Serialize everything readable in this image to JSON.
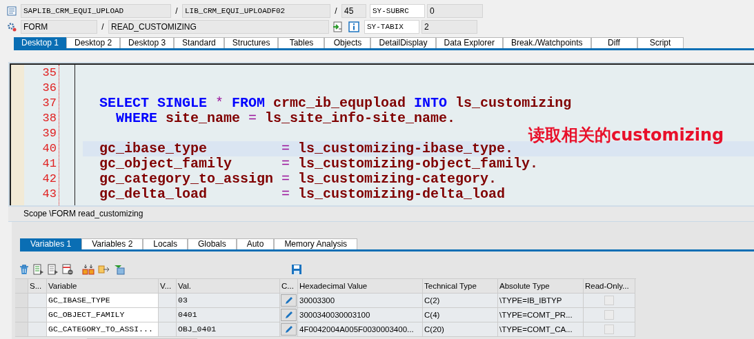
{
  "header": {
    "separators": [
      "/",
      "/",
      "/"
    ],
    "program": "SAPLIB_CRM_EQUI_UPLOAD",
    "include": "LIB_CRM_EQUI_UPLOADF02",
    "line": "45",
    "event_type": "FORM",
    "event_name": "READ_CUSTOMIZING",
    "system_fields": [
      {
        "name": "SY-SUBRC",
        "value": "0"
      },
      {
        "name": "SY-TABIX",
        "value": "2"
      }
    ]
  },
  "desktop_tabs": [
    {
      "label": "Desktop 1",
      "selected": true
    },
    {
      "label": "Desktop 2",
      "selected": false
    },
    {
      "label": "Desktop 3",
      "selected": false
    },
    {
      "label": "Standard",
      "selected": false
    },
    {
      "label": "Structures",
      "selected": false
    },
    {
      "label": "Tables",
      "selected": false
    },
    {
      "label": "Objects",
      "selected": false
    },
    {
      "label": "DetailDisplay",
      "selected": false
    },
    {
      "label": "Data Explorer",
      "selected": false
    },
    {
      "label": "Break./Watchpoints",
      "selected": false
    },
    {
      "label": "Diff",
      "selected": false
    },
    {
      "label": "Script",
      "selected": false
    }
  ],
  "code": {
    "lines": [
      {
        "number": "35",
        "current": false
      },
      {
        "number": "36",
        "current": false
      },
      {
        "number": "37",
        "current": false,
        "continuation": false,
        "tokens": [
          {
            "kind": "keyword",
            "text": "SELECT"
          },
          {
            "kind": "keyword",
            "text": "SINGLE"
          },
          {
            "kind": "operator",
            "text": "*"
          },
          {
            "kind": "keyword",
            "text": "FROM"
          },
          {
            "kind": "identifier",
            "text": "crmc_ib_equpload"
          },
          {
            "kind": "keyword",
            "text": "INTO"
          },
          {
            "kind": "identifier",
            "text": "ls_customizing"
          }
        ]
      },
      {
        "number": "38",
        "current": false,
        "continuation": true,
        "tokens": [
          {
            "kind": "keyword",
            "text": "WHERE"
          },
          {
            "kind": "identifier",
            "text": "site_name"
          },
          {
            "kind": "operator",
            "text": "="
          },
          {
            "kind": "identifier",
            "text": "ls_site_info-site_name."
          }
        ]
      },
      {
        "number": "39",
        "current": false
      },
      {
        "number": "40",
        "current": true,
        "continuation": false,
        "tokens": [
          {
            "kind": "target",
            "text": "gc_ibase_type"
          },
          {
            "kind": "operator",
            "text": "="
          },
          {
            "kind": "identifier",
            "text": "ls_customizing-ibase_type."
          }
        ]
      },
      {
        "number": "41",
        "current": false,
        "continuation": false,
        "tokens": [
          {
            "kind": "target",
            "text": "gc_object_family"
          },
          {
            "kind": "operator",
            "text": "="
          },
          {
            "kind": "identifier",
            "text": "ls_customizing-object_family."
          }
        ]
      },
      {
        "number": "42",
        "current": false,
        "continuation": false,
        "tokens": [
          {
            "kind": "target",
            "text": "gc_category_to_assign"
          },
          {
            "kind": "operator",
            "text": "="
          },
          {
            "kind": "identifier",
            "text": "ls_customizing-category."
          }
        ]
      },
      {
        "number": "43",
        "current": false,
        "continuation": false,
        "tokens": [
          {
            "kind": "target",
            "text": "gc_delta_load"
          },
          {
            "kind": "operator",
            "text": "="
          },
          {
            "kind": "identifier",
            "text": "ls_customizing-delta_load"
          }
        ]
      }
    ],
    "annotation": "读取相关的customizing"
  },
  "scope": "Scope \\FORM read_customizing",
  "variable_tabs": [
    {
      "label": "Variables 1",
      "selected": true
    },
    {
      "label": "Variables 2",
      "selected": false
    },
    {
      "label": "Locals",
      "selected": false
    },
    {
      "label": "Globals",
      "selected": false
    },
    {
      "label": "Auto",
      "selected": false
    },
    {
      "label": "Memory Analysis",
      "selected": false
    }
  ],
  "table": {
    "columns": [
      "S...",
      "Variable",
      "V...",
      "Val.",
      "C...",
      "Hexadecimal Value",
      "Technical Type",
      "Absolute Type",
      "Read-Only..."
    ],
    "rows": [
      {
        "variable": "GC_IBASE_TYPE",
        "value": "03",
        "hex": "30003300",
        "technical_type": "C(2)",
        "absolute_type": "\\TYPE=IB_IBTYP",
        "read_only": false
      },
      {
        "variable": "GC_OBJECT_FAMILY",
        "value": "0401",
        "hex": "3000340030003100",
        "technical_type": "C(4)",
        "absolute_type": "\\TYPE=COMT_PR...",
        "read_only": false
      },
      {
        "variable": "GC_CATEGORY_TO_ASSI...",
        "value": "OBJ_0401",
        "hex": "4F0042004A005F0030003400...",
        "technical_type": "C(20)",
        "absolute_type": "\\TYPE=COMT_CA...",
        "read_only": false
      }
    ]
  }
}
